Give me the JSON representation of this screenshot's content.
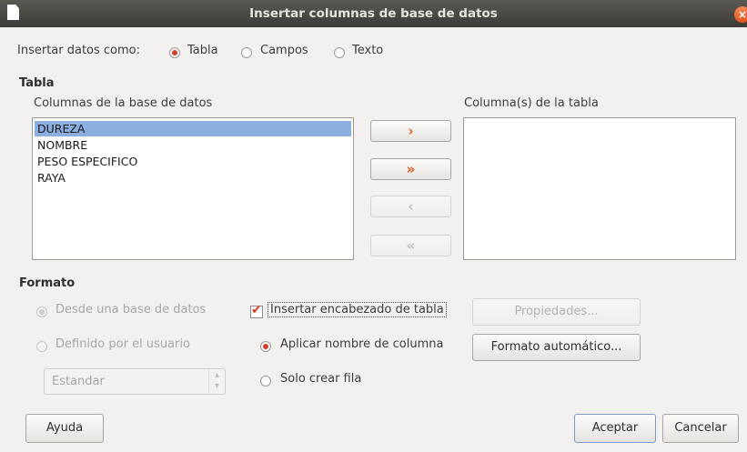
{
  "window": {
    "title": "Insertar columnas de base de datos",
    "close": "×"
  },
  "insert_as": {
    "label": "Insertar datos como:",
    "options": [
      {
        "label": "Tabla",
        "selected": true
      },
      {
        "label": "Campos",
        "selected": false
      },
      {
        "label": "Texto",
        "selected": false
      }
    ]
  },
  "table_section": {
    "heading": "Tabla",
    "db_columns_label": "Columnas de la base de datos",
    "db_columns": [
      "DUREZA",
      "NOMBRE",
      "PESO ESPECIFICO",
      "RAYA"
    ],
    "selected_index": 0,
    "table_columns_label": "Columna(s) de la tabla",
    "move_buttons": [
      {
        "glyph": "›",
        "enabled": true
      },
      {
        "glyph": "»",
        "enabled": true
      },
      {
        "glyph": "‹",
        "enabled": false
      },
      {
        "glyph": "«",
        "enabled": false
      }
    ]
  },
  "format_section": {
    "heading": "Formato",
    "from_db_label": "Desde una base de datos",
    "user_defined_label": "Definido por el usuario",
    "style_combo_value": "Estandar",
    "insert_header_label": "Insertar encabezado de tabla",
    "insert_header_checked": true,
    "apply_column_name_label": "Aplicar nombre de columna",
    "only_row_label": "Solo crear fila",
    "properties_button": "Propiedades...",
    "autoformat_button": "Formato automático..."
  },
  "footer": {
    "help": "Ayuda",
    "ok": "Aceptar",
    "cancel": "Cancelar"
  },
  "colors": {
    "accent": "#d5402a",
    "selection": "#8aaede",
    "arrow": "#e05a1a"
  }
}
